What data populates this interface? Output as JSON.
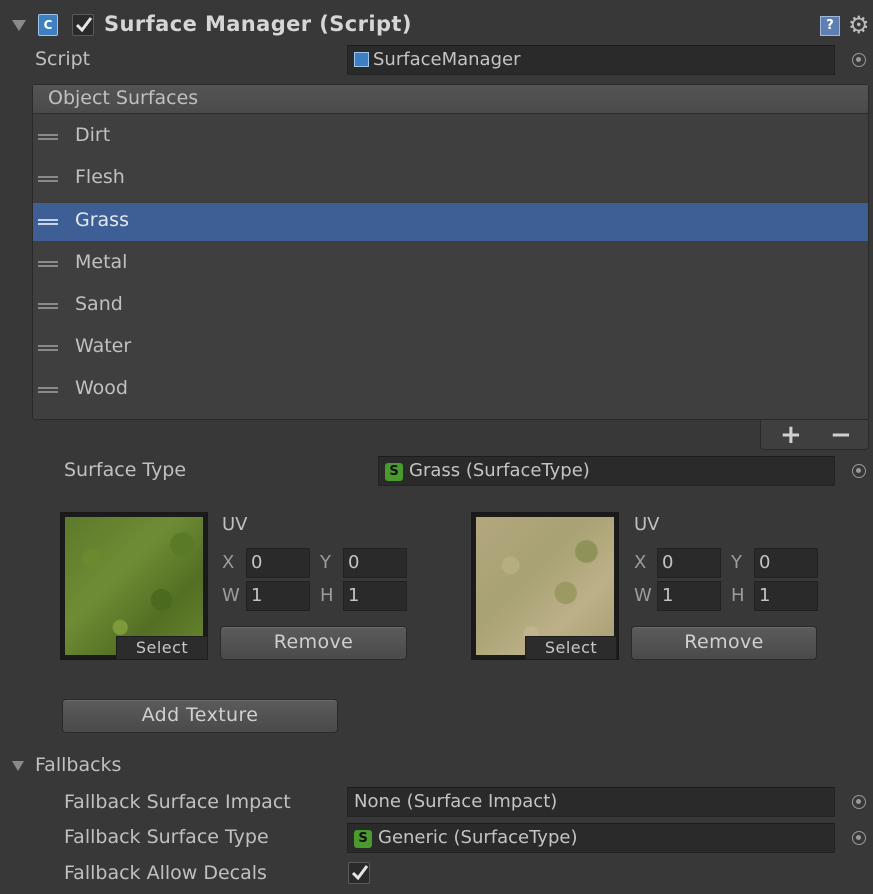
{
  "component": {
    "title": "Surface Manager (Script)",
    "enabled": true,
    "icon": "csharp-script-icon"
  },
  "script": {
    "label": "Script",
    "value": "SurfaceManager"
  },
  "object_surfaces": {
    "header": "Object Surfaces",
    "items": [
      {
        "label": "Dirt",
        "selected": false
      },
      {
        "label": "Flesh",
        "selected": false
      },
      {
        "label": "Grass",
        "selected": true
      },
      {
        "label": "Metal",
        "selected": false
      },
      {
        "label": "Sand",
        "selected": false
      },
      {
        "label": "Water",
        "selected": false
      },
      {
        "label": "Wood",
        "selected": false
      }
    ],
    "add_label": "+",
    "remove_label": "−"
  },
  "surface_type": {
    "label": "Surface Type",
    "value": "Grass (SurfaceType)"
  },
  "textures": [
    {
      "uv_label": "UV",
      "x_label": "X",
      "x": "0",
      "y_label": "Y",
      "y": "0",
      "w_label": "W",
      "w": "1",
      "h_label": "H",
      "h": "1",
      "select_label": "Select",
      "remove_label": "Remove"
    },
    {
      "uv_label": "UV",
      "x_label": "X",
      "x": "0",
      "y_label": "Y",
      "y": "0",
      "w_label": "W",
      "w": "1",
      "h_label": "H",
      "h": "1",
      "select_label": "Select",
      "remove_label": "Remove"
    }
  ],
  "add_texture_label": "Add Texture",
  "fallbacks": {
    "header": "Fallbacks",
    "impact_label": "Fallback Surface Impact",
    "impact_value": "None (Surface Impact)",
    "type_label": "Fallback Surface Type",
    "type_value": "Generic (SurfaceType)",
    "decals_label": "Fallback Allow Decals",
    "decals_checked": true
  },
  "colors": {
    "background": "#383838",
    "selection": "#3e5f96",
    "field": "#2a2a2a"
  }
}
